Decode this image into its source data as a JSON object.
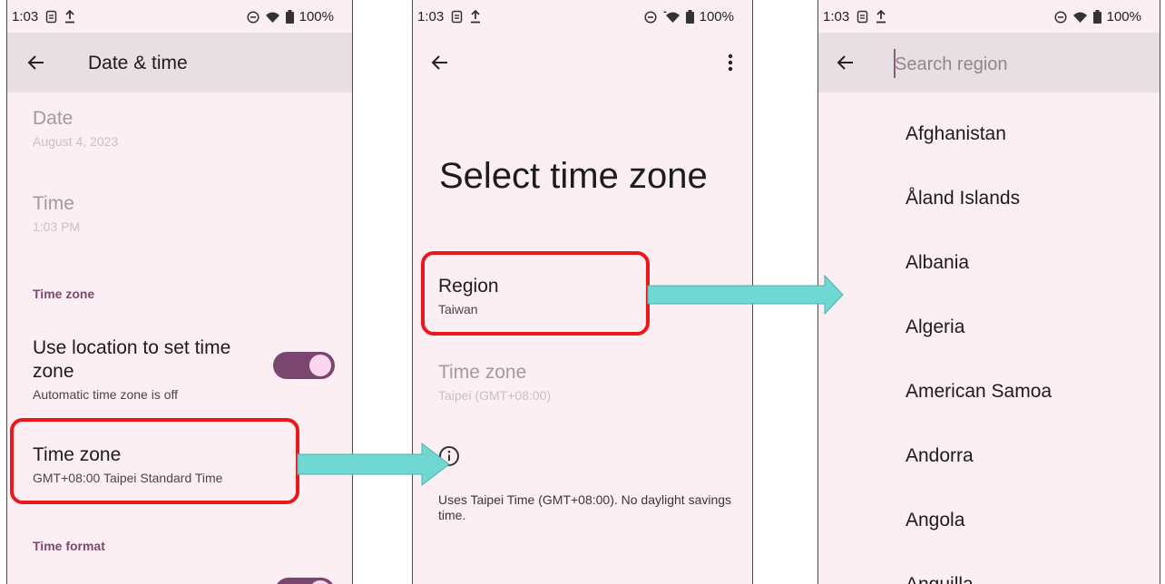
{
  "status_bar": {
    "time": "1:03",
    "battery": "100%"
  },
  "screen1": {
    "title": "Date & time",
    "date": {
      "title": "Date",
      "value": "August 4, 2023"
    },
    "time": {
      "title": "Time",
      "value": "1:03 PM"
    },
    "time_zone_section": "Time zone",
    "use_location": {
      "title": "Use location to set time zone",
      "subtitle": "Automatic time zone is off",
      "enabled": true
    },
    "time_zone": {
      "title": "Time zone",
      "value": "GMT+08:00 Taipei Standard Time"
    },
    "time_format_section": "Time format"
  },
  "screen2": {
    "title": "Select time zone",
    "region": {
      "title": "Region",
      "value": "Taiwan"
    },
    "time_zone": {
      "title": "Time zone",
      "value": "Taipei (GMT+08:00)"
    },
    "footer": "Uses Taipei Time (GMT+08:00). No daylight savings time."
  },
  "screen3": {
    "search_placeholder": "Search region",
    "regions": [
      "Afghanistan",
      "Åland Islands",
      "Albania",
      "Algeria",
      "American Samoa",
      "Andorra",
      "Angola",
      "Anguilla"
    ]
  },
  "colors": {
    "background": "#fbeff3",
    "appbar": "#e8dfe3",
    "accent": "#7a4670",
    "section_header": "#7b4a6d",
    "highlight": "#e8181c",
    "arrow": "#6fd8d3"
  },
  "icons": [
    "back-arrow-icon",
    "more-vert-icon",
    "info-icon",
    "wifi-icon",
    "battery-icon",
    "dnd-icon",
    "upload-icon",
    "sim-icon"
  ]
}
